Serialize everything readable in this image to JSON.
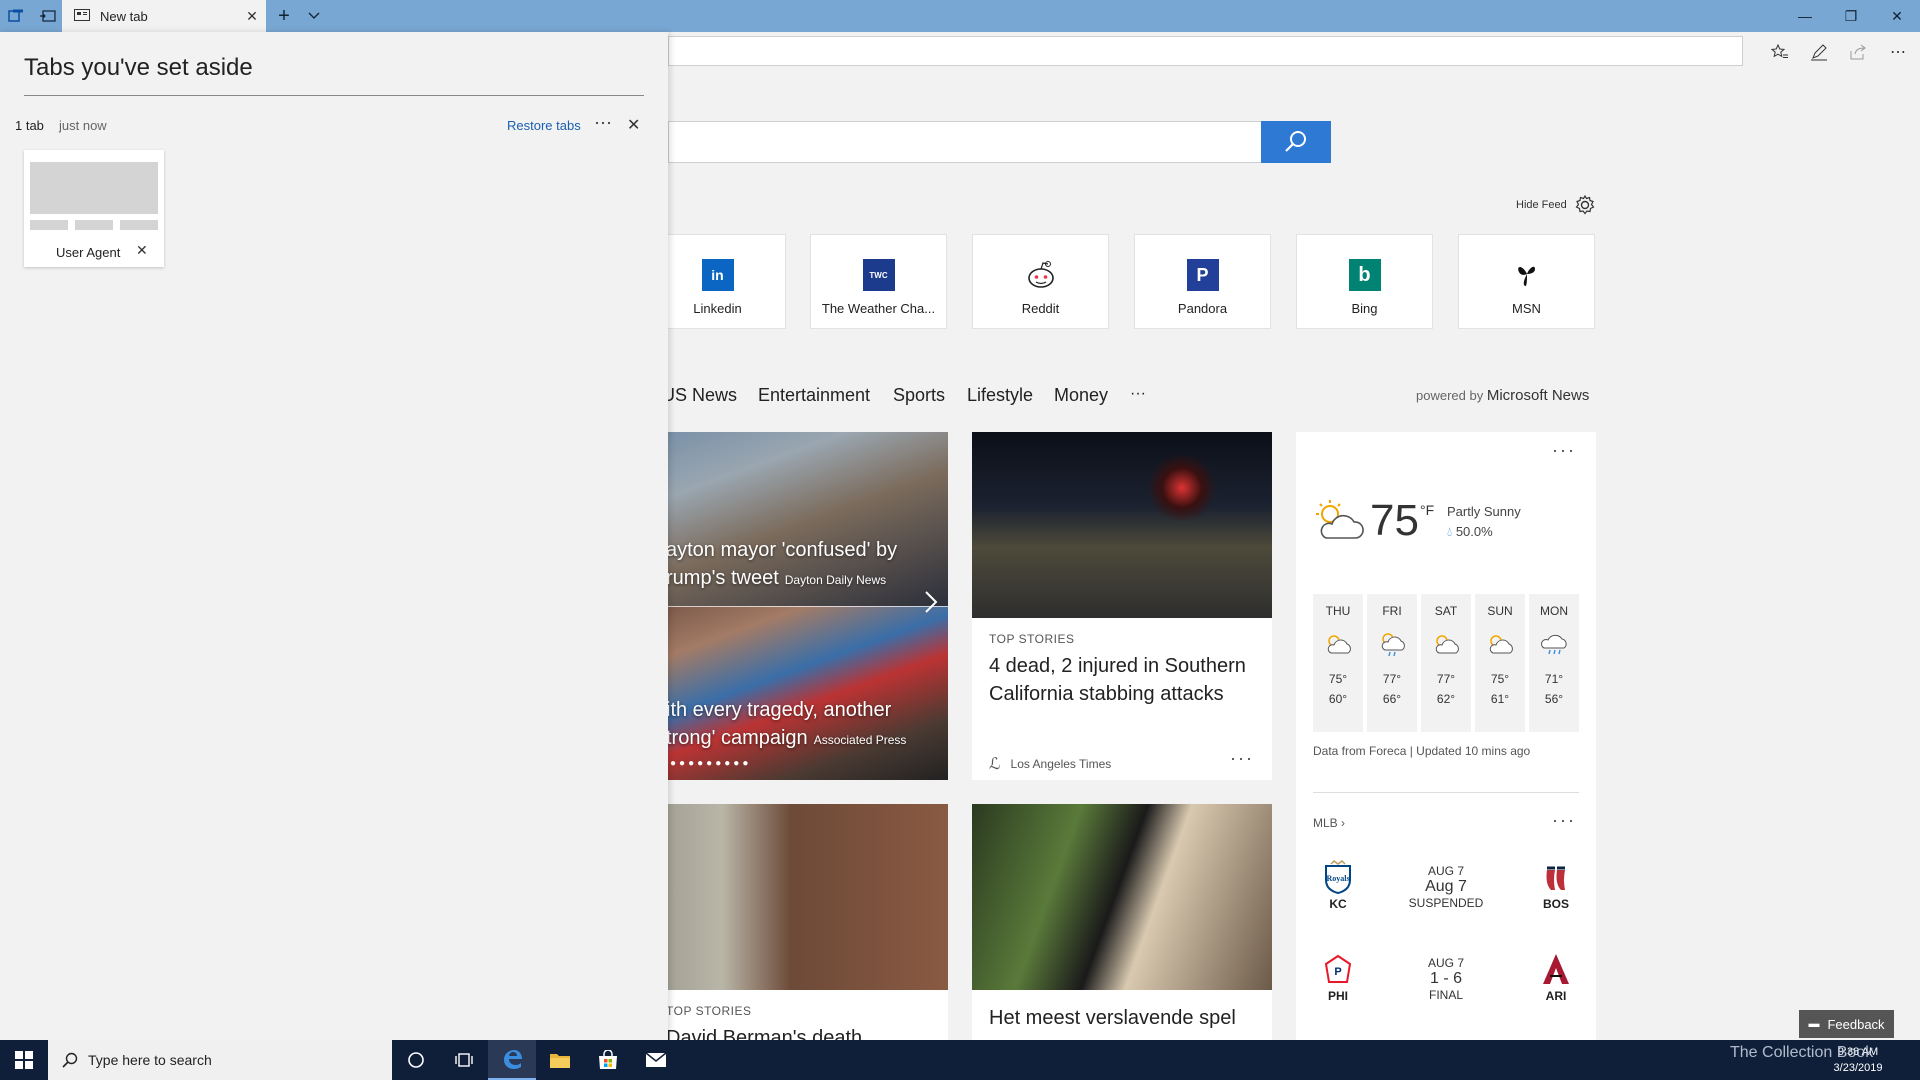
{
  "browser": {
    "tab_title": "New tab",
    "tab_close": "✕",
    "new_tab": "+",
    "window_controls": {
      "minimize": "—",
      "restore": "❐",
      "close": "✕"
    }
  },
  "side_panel": {
    "title": "Tabs you've set aside",
    "count": "1 tab",
    "time": "just now",
    "restore_label": "Restore tabs",
    "more": "···",
    "close": "✕",
    "tab_label": "User Agent",
    "tab_close": "✕"
  },
  "main": {
    "hide_feed": "Hide Feed",
    "top_sites": [
      {
        "label": "Linkedin",
        "logo_text": "in",
        "color": "#0a66c2"
      },
      {
        "label": "The Weather Cha...",
        "logo_text": "TWC",
        "color": "#1d3b8c"
      },
      {
        "label": "Reddit",
        "logo_text": "",
        "color": "#ffffff"
      },
      {
        "label": "Pandora",
        "logo_text": "P",
        "color": "#224099"
      },
      {
        "label": "Bing",
        "logo_text": "b",
        "color": "#008373"
      },
      {
        "label": "MSN",
        "logo_text": "",
        "color": "#ffffff"
      }
    ],
    "categories": [
      "US News",
      "Entertainment",
      "Sports",
      "Lifestyle",
      "Money",
      "···"
    ],
    "powered_prefix": "powered by",
    "powered_brand": "Microsoft News"
  },
  "cards": {
    "carousel_1_headline": "ayton mayor 'confused' by rump's tweet",
    "carousel_1_source": "Dayton Daily News",
    "carousel_2_headline": "ith every tragedy, another trong' campaign",
    "carousel_2_source": "Associated Press",
    "story_1_kicker": "TOP STORIES",
    "story_1_headline": "4 dead, 2 injured in Southern California stabbing attacks",
    "story_1_source": "Los Angeles Times",
    "story_1_more": "···",
    "story_2_kicker": "TOP STORIES",
    "story_2_headline": "David Berman's death",
    "story_3_headline": "Het meest verslavende spel"
  },
  "weather": {
    "temp": "75",
    "unit": "°F",
    "condition": "Partly Sunny",
    "precip": "50.0%",
    "more": "···",
    "days": [
      {
        "name": "THU",
        "hi": "75°",
        "lo": "60°"
      },
      {
        "name": "FRI",
        "hi": "77°",
        "lo": "66°"
      },
      {
        "name": "SAT",
        "hi": "77°",
        "lo": "62°"
      },
      {
        "name": "SUN",
        "hi": "75°",
        "lo": "61°"
      },
      {
        "name": "MON",
        "hi": "71°",
        "lo": "56°"
      }
    ],
    "footer": "Data from Foreca | Updated 10 mins ago"
  },
  "mlb": {
    "label": "MLB",
    "more": "···",
    "games": [
      {
        "away": "KC",
        "home": "BOS",
        "top": "AUG 7",
        "mid": "Aug 7",
        "bottom": "SUSPENDED"
      },
      {
        "away": "PHI",
        "home": "ARI",
        "top": "AUG 7",
        "mid": "1 - 6",
        "bottom": "FINAL"
      }
    ]
  },
  "feedback_label": "Feedback",
  "taskbar": {
    "search_placeholder": "Type here to search",
    "time": "9:38 AM",
    "date": "3/23/2019",
    "watermark": "The Collection Book"
  }
}
